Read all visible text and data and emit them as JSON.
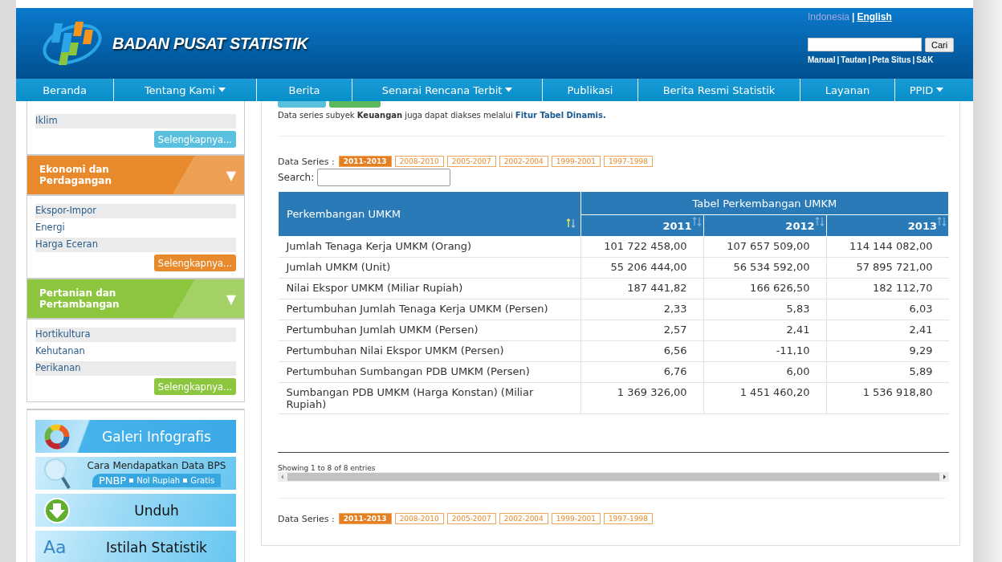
{
  "header": {
    "site_name": "BADAN PUSAT STATISTIK",
    "languages": [
      {
        "label": "Indonesia",
        "selected": true
      },
      {
        "label": "English",
        "selected": false
      }
    ],
    "language_separator": "|",
    "search_button": "Cari",
    "links": [
      "Manual",
      "Tautan",
      "Peta Situs",
      "S&K"
    ],
    "link_separators": [
      "|",
      "|",
      "|"
    ]
  },
  "nav": [
    {
      "label": "Beranda",
      "dropdown": false
    },
    {
      "label": "Tentang Kami",
      "dropdown": true
    },
    {
      "label": "Berita",
      "dropdown": false
    },
    {
      "label": "Senarai Rencana Terbit",
      "dropdown": true
    },
    {
      "label": "Publikasi",
      "dropdown": false
    },
    {
      "label": "Berita Resmi Statistik",
      "dropdown": false
    },
    {
      "label": "Layanan",
      "dropdown": false
    },
    {
      "label": "PPID",
      "dropdown": true
    }
  ],
  "sidebar": {
    "sections": [
      {
        "color": "#5bc0de",
        "items": [
          "Iklim"
        ],
        "more": "Selengkapnya..."
      },
      {
        "color": "#e8892b",
        "title": "Ekonomi dan Perdagangan",
        "toggle": "▼",
        "items": [
          "Ekspor-Impor",
          "Energi",
          "Harga Eceran"
        ],
        "more": "Selengkapnya..."
      },
      {
        "color": "#8cc63f",
        "title": "Pertanian dan Pertambangan",
        "toggle": "▼",
        "items": [
          "Hortikultura",
          "Kehutanan",
          "Perikanan"
        ],
        "more": "Selengkapnya..."
      }
    ],
    "banners": [
      {
        "kind": "infographic",
        "title": "Galeri Infografis"
      },
      {
        "kind": "magnifier",
        "title": "Cara Mendapatkan Data BPS",
        "subtitle": [
          "PNBP",
          "Nol Rupiah",
          "Gratis"
        ]
      },
      {
        "kind": "download",
        "title": "Unduh"
      },
      {
        "kind": "glossary",
        "icon_text": "Aa",
        "title": "Istilah Statistik"
      }
    ]
  },
  "main": {
    "note": "Data series subyek **Keuangan** juga dapat diakses melalui ",
    "note_link": "Fitur Tabel Dinamis.",
    "series_label": "Data Series :",
    "series": [
      {
        "label": "2011-2013",
        "selected": true
      },
      {
        "label": "2008-2010",
        "selected": false
      },
      {
        "label": "2005-2007",
        "selected": false
      },
      {
        "label": "2002-2004",
        "selected": false
      },
      {
        "label": "1999-2001",
        "selected": false
      },
      {
        "label": "1997-1998",
        "selected": false
      }
    ],
    "search_label": "Search:",
    "table": {
      "row_header": "Perkembangan UMKM",
      "group_header": "Tabel Perkembangan UMKM",
      "columns": [
        "2011",
        "2012",
        "2013"
      ],
      "rows": [
        {
          "label": "Jumlah Tenaga Kerja UMKM (Orang)",
          "values": [
            "101 722 458,00",
            "107 657 509,00",
            "114 144 082,00"
          ]
        },
        {
          "label": "Jumlah UMKM (Unit)",
          "values": [
            "55 206 444,00",
            "56 534 592,00",
            "57 895 721,00"
          ]
        },
        {
          "label": "Nilai Ekspor UMKM (Miliar Rupiah)",
          "values": [
            "187 441,82",
            "166 626,50",
            "182 112,70"
          ]
        },
        {
          "label": "Pertumbuhan Jumlah Tenaga Kerja UMKM (Persen)",
          "values": [
            "2,33",
            "5,83",
            "6,03"
          ]
        },
        {
          "label": "Pertumbuhan Jumlah UMKM (Persen)",
          "values": [
            "2,57",
            "2,41",
            "2,41"
          ]
        },
        {
          "label": "Pertumbuhan Nilai Ekspor UMKM (Persen)",
          "values": [
            "6,56",
            "-11,10",
            "9,29"
          ]
        },
        {
          "label": "Pertumbuhan Sumbangan PDB UMKM (Persen)",
          "values": [
            "6,76",
            "6,00",
            "5,89"
          ]
        },
        {
          "label": "Sumbangan PDB UMKM (Harga Konstan) (Miliar Rupiah)",
          "values": [
            "1 369 326,00",
            "1 451 460,20",
            "1 536 918,80"
          ]
        }
      ]
    },
    "info": "Showing 1 to 8 of 8 entries",
    "bottom_series_label": "Data Series :",
    "bottom_series": [
      {
        "label": "2011-2013",
        "selected": true
      },
      {
        "label": "2008-2010",
        "selected": false
      },
      {
        "label": "2005-2007",
        "selected": false
      },
      {
        "label": "2002-2004",
        "selected": false
      },
      {
        "label": "1999-2001",
        "selected": false
      },
      {
        "label": "1997-1998",
        "selected": false
      }
    ]
  }
}
